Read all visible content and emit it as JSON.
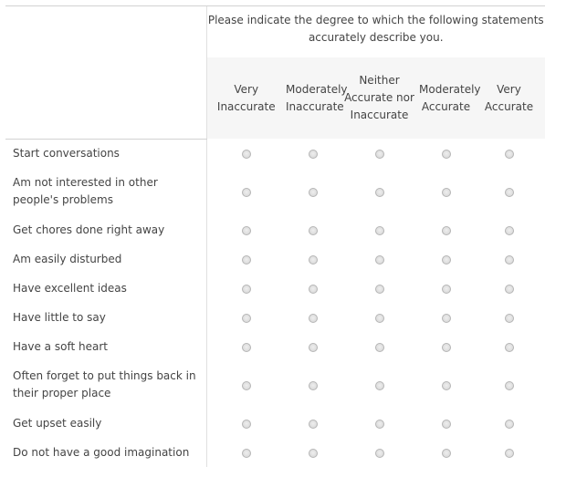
{
  "prompt": "Please indicate the degree to which the following statements accurately describe you.",
  "scale": [
    "Very Inaccurate",
    "Moderately Inaccurate",
    "Neither Accurate nor Inaccurate",
    "Moderately Accurate",
    "Very Accurate"
  ],
  "statements": [
    "Start conversations",
    "Am not interested in other people's problems",
    "Get chores done right away",
    "Am easily disturbed",
    "Have excellent ideas",
    "Have little to say",
    "Have a soft heart",
    "Often forget to put things back in their proper place",
    "Get upset easily",
    "Do not have a good imagination"
  ]
}
